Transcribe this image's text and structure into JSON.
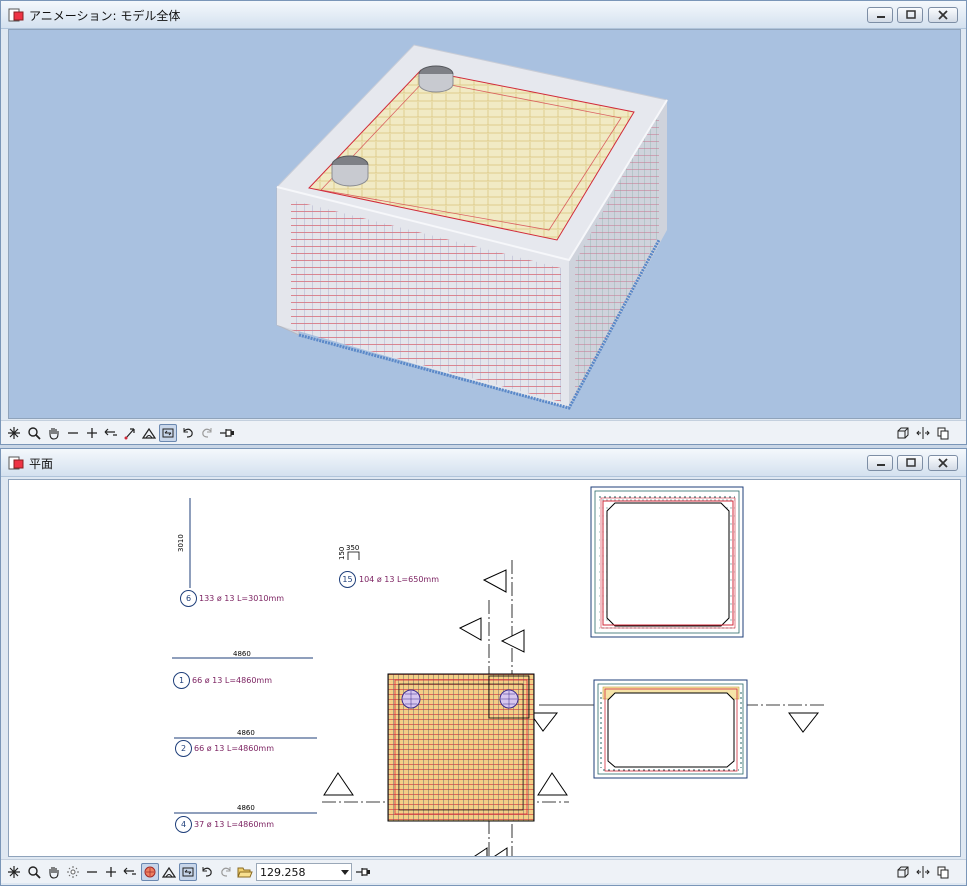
{
  "windows": {
    "animation": {
      "title": "アニメーション: モデル全体"
    },
    "plan": {
      "title": "平面"
    }
  },
  "plan": {
    "bar_marks": [
      {
        "id": "6",
        "label": "133 ø 13  L=3010mm",
        "dim": "3010"
      },
      {
        "id": "15",
        "label": "104 ø 13  L=650mm",
        "dim_a": "150",
        "dim_b": "350"
      },
      {
        "id": "1",
        "label": "66 ø 13  L=4860mm",
        "dim": "4860"
      },
      {
        "id": "2",
        "label": "66 ø 13  L=4860mm",
        "dim": "4860"
      },
      {
        "id": "4",
        "label": "37 ø 13  L=4860mm",
        "dim": "4860"
      }
    ]
  },
  "toolbar": {
    "zoom_value": "129.258"
  },
  "icons": [
    "app-icon",
    "minimize-icon",
    "maximize-icon",
    "close-icon",
    "asterisk-icon",
    "zoom-icon",
    "pan-hand-icon",
    "minus-icon",
    "plus-icon",
    "arrow-left-icon",
    "axis-icon",
    "home-icon",
    "rotate-icon",
    "undo-icon",
    "redo-icon",
    "pin-icon",
    "sun-icon",
    "render-icon",
    "open-folder-icon",
    "3d-box-icon",
    "split-icon",
    "copy-icon"
  ],
  "colors": {
    "background_3d": "#a9c1e0",
    "rebar_red": "#d12a3a",
    "rebar_yellow": "#e8c34a",
    "concrete": "#e6e8ee",
    "mark_text": "#7a1f5f"
  }
}
